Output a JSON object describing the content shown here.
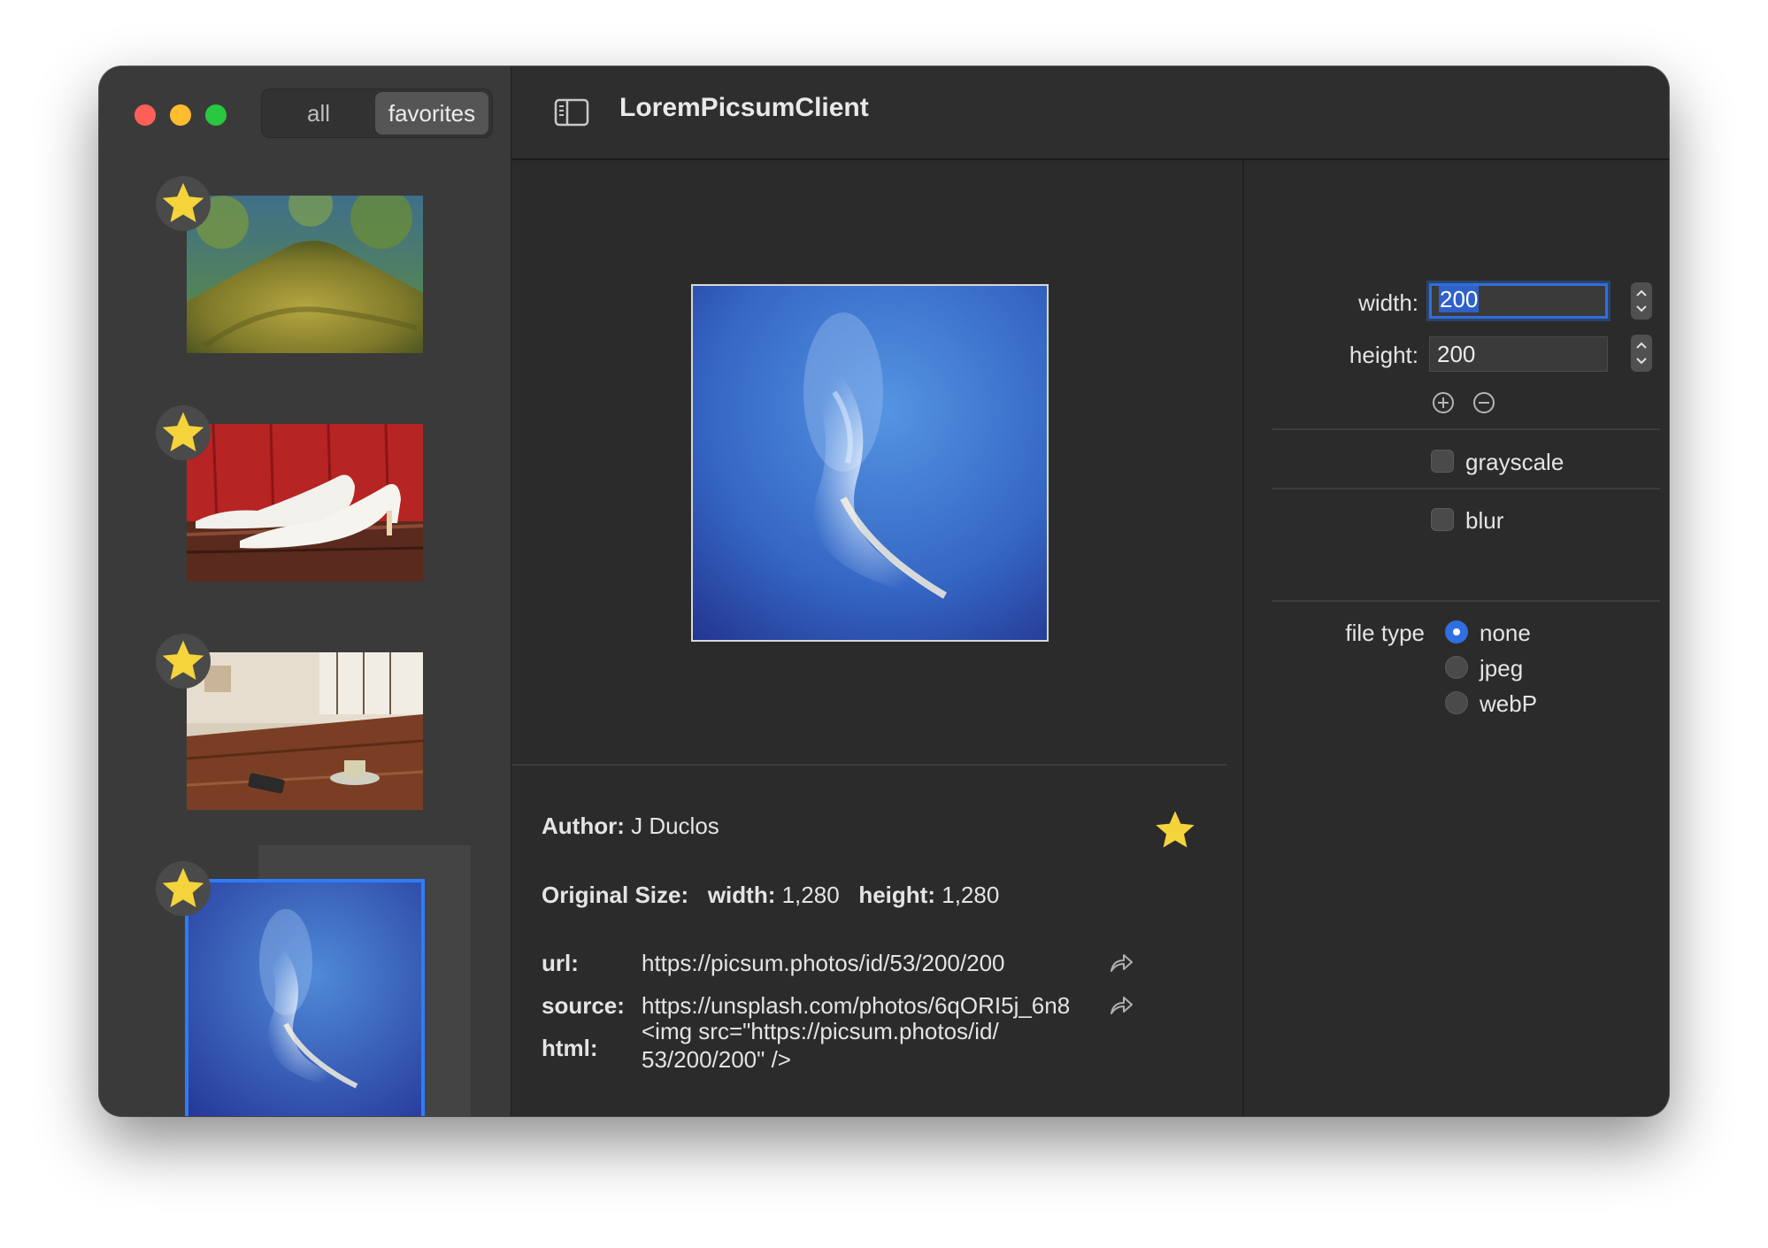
{
  "window": {
    "traffic_lights": [
      "close",
      "minimize",
      "zoom"
    ]
  },
  "sidebar": {
    "segments": {
      "all": "all",
      "favorites": "favorites",
      "selected": "favorites"
    },
    "thumbnails": [
      {
        "subject": "mossy tree photo",
        "favorite": true,
        "selected": false
      },
      {
        "subject": "white shoes photo",
        "favorite": true,
        "selected": false
      },
      {
        "subject": "cafe table photo",
        "favorite": true,
        "selected": false
      },
      {
        "subject": "blue sky cloud photo",
        "favorite": true,
        "selected": true
      }
    ]
  },
  "toolbar": {
    "title": "LoremPicsumClient",
    "sidebar_toggle_icon": "sidebar-toggle-icon"
  },
  "detail": {
    "author_label": "Author:",
    "author": "J Duclos",
    "original_size_label": "Original Size:",
    "width_label": "width:",
    "width_value": "1,280",
    "height_label": "height:",
    "height_value": "1,280",
    "url_label": "url:",
    "url": "https://picsum.photos/id/53/200/200",
    "source_label": "source:",
    "source": "https://unsplash.com/photos/6qORI5j_6n8",
    "html_label": "html:",
    "html_line1": "<img src=\"https://picsum.photos/id/",
    "html_line2": "53/200/200\" />",
    "favorite": true
  },
  "settings": {
    "width_label": "width:",
    "width_value": "200",
    "height_label": "height:",
    "height_value": "200",
    "grayscale_label": "grayscale",
    "grayscale_checked": false,
    "blur_label": "blur",
    "blur_checked": false,
    "file_type_label": "file type",
    "file_types": [
      "none",
      "jpeg",
      "webP"
    ],
    "file_type_selected": "none"
  },
  "colors": {
    "accent": "#2f6fe0",
    "star": "#f5d33b",
    "window_bg": "#2b2b2b",
    "sidebar_bg": "#3a3a3a"
  }
}
